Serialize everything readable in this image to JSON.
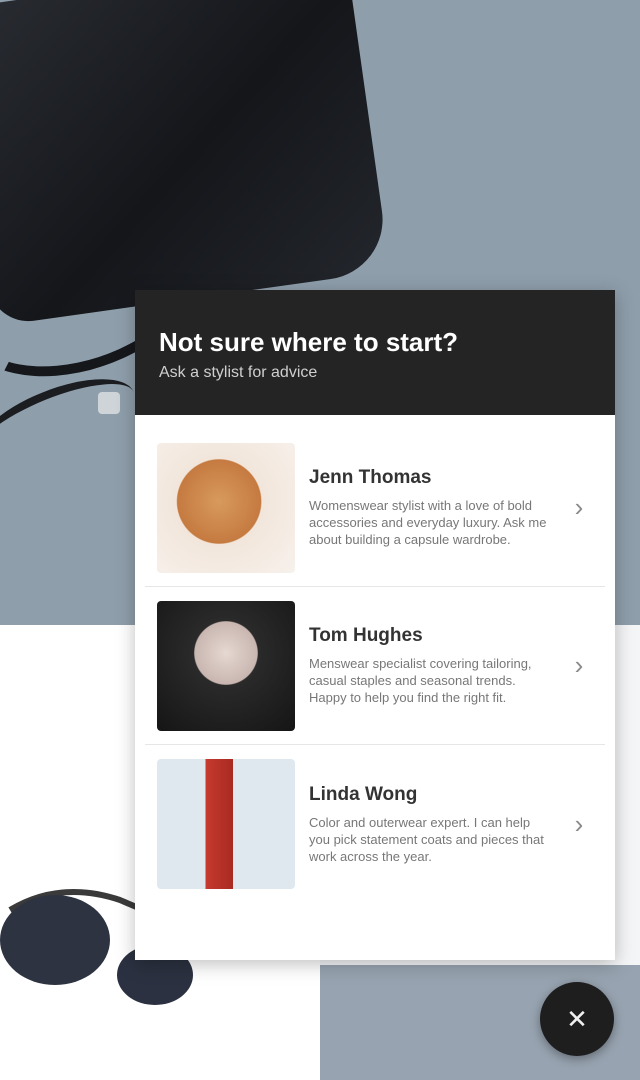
{
  "background": {
    "side_caption": "",
    "accent": "#8e9eab"
  },
  "modal": {
    "title": "Not sure where to start?",
    "subtitle": "Ask a stylist for advice",
    "stylists": [
      {
        "name": "Jenn Thomas",
        "description": "Womenswear stylist with a love of bold accessories and everyday luxury. Ask me about building a capsule wardrobe.",
        "icon": "chevron-right-icon"
      },
      {
        "name": "Tom Hughes",
        "description": "Menswear specialist covering tailoring, casual staples and seasonal trends. Happy to help you find the right fit.",
        "icon": "chevron-right-icon"
      },
      {
        "name": "Linda Wong",
        "description": "Color and outerwear expert. I can help you pick statement coats and pieces that work across the year.",
        "icon": "chevron-right-icon"
      }
    ]
  },
  "fab": {
    "icon": "close-icon",
    "glyph": "✕"
  }
}
